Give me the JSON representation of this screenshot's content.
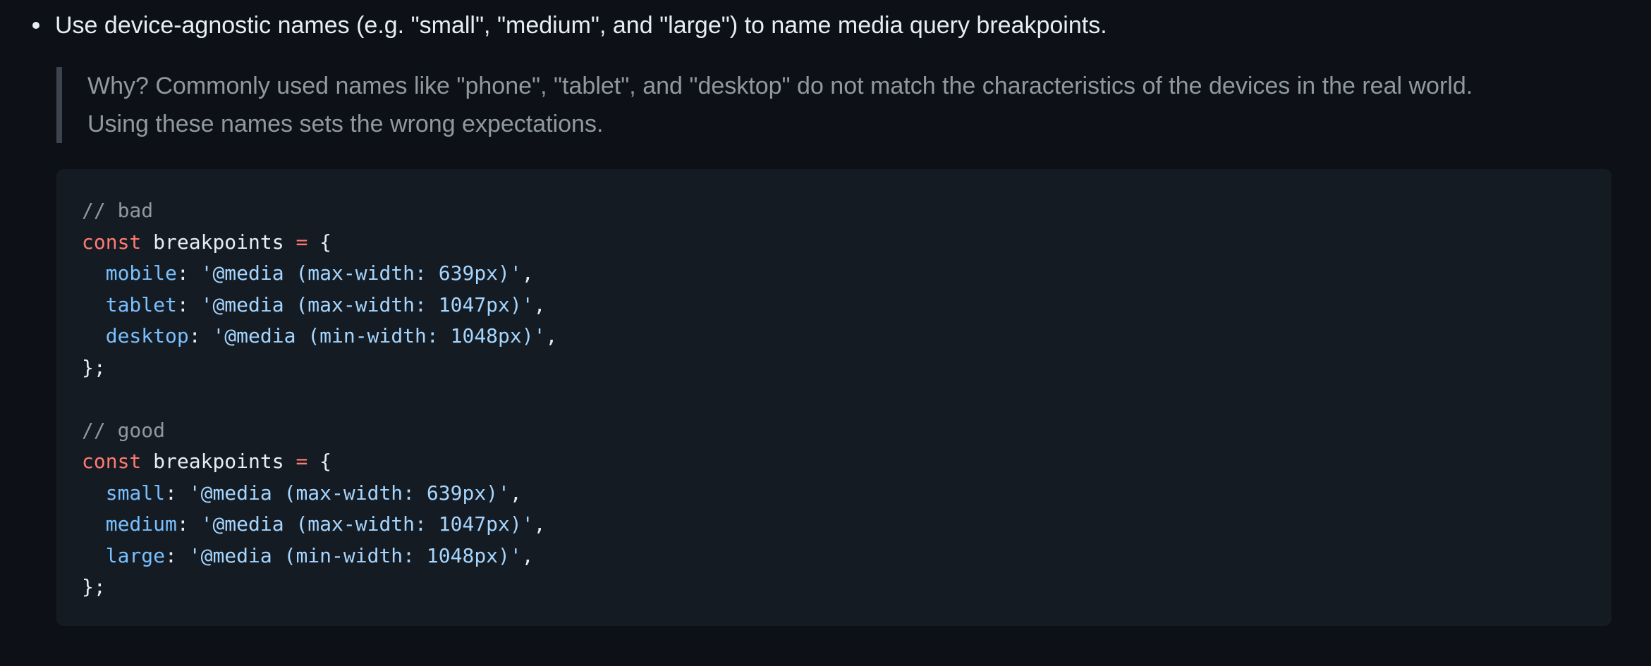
{
  "bullet": {
    "text": "Use device-agnostic names (e.g. \"small\", \"medium\", and \"large\") to name media query breakpoints."
  },
  "quote": {
    "line1": "Why? Commonly used names like \"phone\", \"tablet\", and \"desktop\" do not match the characteristics of the devices in the real world.",
    "line2": "Using these names sets the wrong expectations."
  },
  "code": {
    "bad": {
      "comment": "// bad",
      "keyword": "const",
      "name": "breakpoints",
      "op": "=",
      "open": "{",
      "entries": [
        {
          "key": "mobile",
          "value": "'@media (max-width: 639px)'"
        },
        {
          "key": "tablet",
          "value": "'@media (max-width: 1047px)'"
        },
        {
          "key": "desktop",
          "value": "'@media (min-width: 1048px)'"
        }
      ],
      "close": "};"
    },
    "good": {
      "comment": "// good",
      "keyword": "const",
      "name": "breakpoints",
      "op": "=",
      "open": "{",
      "entries": [
        {
          "key": "small",
          "value": "'@media (max-width: 639px)'"
        },
        {
          "key": "medium",
          "value": "'@media (max-width: 1047px)'"
        },
        {
          "key": "large",
          "value": "'@media (min-width: 1048px)'"
        }
      ],
      "close": "};"
    }
  }
}
